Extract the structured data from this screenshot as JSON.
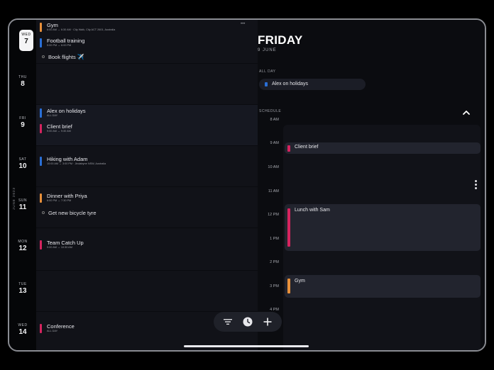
{
  "rail": {
    "month_label": "JUNE 2023",
    "days": [
      {
        "dow": "WED",
        "num": "7"
      },
      {
        "dow": "THU",
        "num": "8"
      },
      {
        "dow": "FRI",
        "num": "9"
      },
      {
        "dow": "SAT",
        "num": "10"
      },
      {
        "dow": "SUN",
        "num": "11"
      },
      {
        "dow": "MON",
        "num": "12"
      },
      {
        "dow": "TUE",
        "num": "13"
      },
      {
        "dow": "WED",
        "num": "14"
      }
    ]
  },
  "agenda": {
    "events": [
      {
        "title": "Gym",
        "sub": "6:00 AM → 6:30 AM  ·  City Walk, City ACT 2601, Australia",
        "color": "#e8903a"
      },
      {
        "title": "Football training",
        "sub": "5:00 PM → 6:00 PM",
        "color": "#2a6fd6"
      },
      {
        "title": "Alex on holidays",
        "sub": "ALL DAY",
        "color": "#2a6fd6"
      },
      {
        "title": "Client brief",
        "sub": "9:00 AM → 9:30 AM",
        "color": "#d6245f"
      },
      {
        "title": "Hiking with Adam",
        "sub": "10:00 AM → 3:00 PM  ·  Jindabyne NSW, Australia",
        "color": "#2a6fd6"
      },
      {
        "title": "Dinner with Priya",
        "sub": "6:00 PM → 7:30 PM",
        "color": "#e8903a"
      },
      {
        "title": "Team Catch Up",
        "sub": "9:00 AM → 10:30 AM",
        "color": "#d6245f"
      },
      {
        "title": "Conference",
        "sub": "ALL DAY",
        "color": "#d6245f"
      }
    ],
    "tasks": [
      {
        "title": "Book flights",
        "emoji": "✈️"
      },
      {
        "title": "Get new bicycle tyre",
        "emoji": ""
      }
    ]
  },
  "detail": {
    "day_title": "FRIDAY",
    "day_sub": "9 JUNE",
    "allday_label": "ALL DAY",
    "allday_event": {
      "title": "Alex on holidays",
      "color": "#2a6fd6"
    },
    "schedule_label": "SCHEDULE",
    "hours": [
      "8 AM",
      "9 AM",
      "10 AM",
      "11 AM",
      "12 PM",
      "1 PM",
      "2 PM",
      "3 PM",
      "4 PM"
    ],
    "blocks": [
      {
        "title": "Client brief",
        "color": "#d6245f"
      },
      {
        "title": "Lunch with Sam",
        "color": "#d6245f"
      },
      {
        "title": "Gym",
        "color": "#e8903a"
      }
    ]
  },
  "toolbar": {
    "icons": [
      "filter-icon",
      "clock-icon",
      "plus-icon"
    ]
  }
}
